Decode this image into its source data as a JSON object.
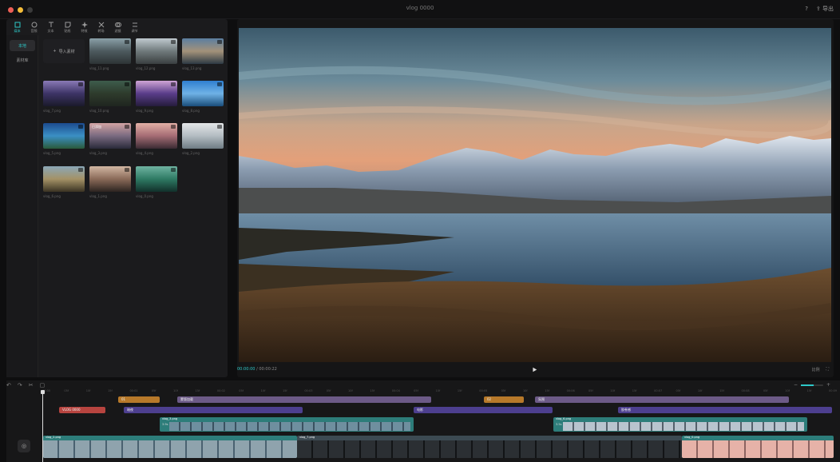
{
  "window": {
    "title": "vlog 0000"
  },
  "titlebar": {
    "export_label": "导出"
  },
  "toolbar": [
    {
      "label": "媒体",
      "icon": "media-icon",
      "active": true
    },
    {
      "label": "音频",
      "icon": "audio-icon"
    },
    {
      "label": "文本",
      "icon": "text-icon"
    },
    {
      "label": "贴纸",
      "icon": "sticker-icon"
    },
    {
      "label": "特效",
      "icon": "effects-icon"
    },
    {
      "label": "转场",
      "icon": "transition-icon"
    },
    {
      "label": "滤镜",
      "icon": "filter-icon"
    },
    {
      "label": "调节",
      "icon": "adjust-icon"
    }
  ],
  "sidebar": {
    "items": [
      {
        "label": "本地",
        "active": true
      },
      {
        "label": "素材库"
      }
    ]
  },
  "media": {
    "import_label": "导入素材",
    "thumbs": [
      {
        "label": "vlog_11.png"
      },
      {
        "label": "vlog_12.png"
      },
      {
        "label": "vlog_13.png"
      },
      {
        "label": "vlog_7.png"
      },
      {
        "label": "vlog_10.png"
      },
      {
        "label": "vlog_9.png"
      },
      {
        "label": "vlog_8.png"
      },
      {
        "label": "vlog_5.png"
      },
      {
        "label": "vlog_3.png",
        "tag": "已添加"
      },
      {
        "label": "vlog_4.png"
      },
      {
        "label": "vlog_2.png"
      },
      {
        "label": "vlog_6.png"
      },
      {
        "label": "vlog_1.png"
      },
      {
        "label": "vlog_0.png"
      }
    ]
  },
  "player": {
    "current": "00:00:00",
    "total": "00:00:22",
    "ratio": "比例"
  },
  "timeline": {
    "ruler": [
      "00:00",
      "05f",
      "10f",
      "15f",
      "00:01",
      "05f",
      "10f",
      "15f",
      "00:02",
      "05f",
      "10f",
      "15f",
      "00:03",
      "05f",
      "10f",
      "15f",
      "00:04",
      "05f",
      "10f",
      "15f",
      "00:05",
      "05f",
      "10f",
      "15f",
      "00:06",
      "05f",
      "10f",
      "15f",
      "00:07",
      "05f",
      "10f",
      "15f",
      "00:08",
      "05f",
      "10f",
      "15f",
      "00:09"
    ],
    "text_clip": "VLOG 0000",
    "sticker_clips": [
      "01",
      "02"
    ],
    "effect_clips": [
      "蒙版加载",
      "氛围"
    ],
    "filter_clips": [
      "暗夜",
      "电影",
      "胶卷感"
    ],
    "overlay_clips": [
      "vlog_3.png",
      "vlog_6.png"
    ],
    "main_clips": [
      "vlog_2.png",
      "vlog_7.png",
      "vlog_0.png"
    ],
    "overlay_durations": [
      "3.9s",
      "3.5s"
    ],
    "cover_label": "封面"
  }
}
